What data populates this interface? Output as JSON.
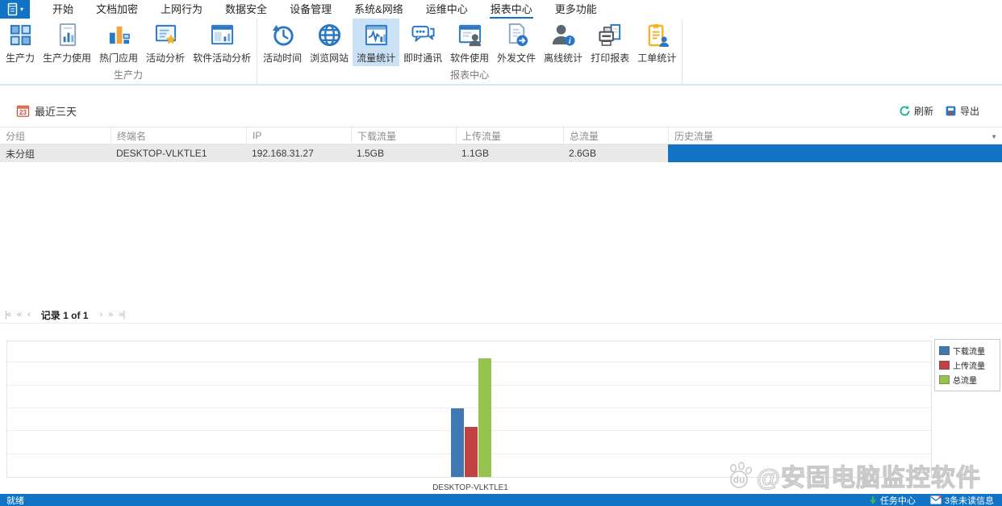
{
  "colors": {
    "accent": "#1173c5",
    "ribbon_highlight": "#cbe2f6",
    "row_background": "#e9e9e9"
  },
  "menu_bar": {
    "items": [
      {
        "label": "开始"
      },
      {
        "label": "文档加密"
      },
      {
        "label": "上网行为"
      },
      {
        "label": "数据安全"
      },
      {
        "label": "设备管理"
      },
      {
        "label": "系统&网络"
      },
      {
        "label": "运维中心"
      },
      {
        "label": "报表中心",
        "selected": true
      },
      {
        "label": "更多功能"
      }
    ]
  },
  "ribbon": {
    "groups": [
      {
        "label": "生产力",
        "buttons": [
          {
            "label": "生产力",
            "icon": "grid-icon"
          },
          {
            "label": "生产力使用",
            "icon": "doc-chart-icon"
          },
          {
            "label": "热门应用",
            "icon": "hot-apps-icon"
          },
          {
            "label": "活动分析",
            "icon": "doc-star-icon"
          },
          {
            "label": "软件活动分析",
            "icon": "window-chart-icon"
          }
        ]
      },
      {
        "label": "报表中心",
        "buttons": [
          {
            "label": "活动时间",
            "icon": "clock-history-icon"
          },
          {
            "label": "浏览网站",
            "icon": "globe-icon"
          },
          {
            "label": "流量统计",
            "icon": "traffic-chart-icon",
            "selected": true
          },
          {
            "label": "即时通讯",
            "icon": "chat-icon"
          },
          {
            "label": "软件使用",
            "icon": "window-user-icon"
          },
          {
            "label": "外发文件",
            "icon": "doc-export-icon"
          },
          {
            "label": "离线统计",
            "icon": "user-info-icon"
          },
          {
            "label": "打印报表",
            "icon": "printer-icon"
          },
          {
            "label": "工单统计",
            "icon": "clipboard-user-icon"
          }
        ]
      }
    ]
  },
  "toolbar": {
    "calendar_day": "23",
    "date_range": "最近三天",
    "refresh": "刷新",
    "export": "导出"
  },
  "table": {
    "columns": [
      "分组",
      "终端名",
      "IP",
      "下载流量",
      "上传流量",
      "总流量",
      "历史流量"
    ],
    "column_keys": [
      "group",
      "terminal",
      "ip",
      "download",
      "upload",
      "total",
      "history_bar"
    ],
    "rows": [
      {
        "group": "未分组",
        "terminal": "DESKTOP-VLKTLE1",
        "ip": "192.168.31.27",
        "download": "1.5GB",
        "upload": "1.1GB",
        "total": "2.6GB",
        "history_bar": true
      }
    ]
  },
  "pagination": {
    "left_controls": [
      "first-page",
      "fast-prev",
      "prev-page"
    ],
    "record_text": "记录 1 of 1",
    "right_controls": [
      "next-page",
      "fast-next",
      "last-page"
    ]
  },
  "chart_data": {
    "type": "bar",
    "title": "",
    "categories": [
      "DESKTOP-VLKTLE1"
    ],
    "series": [
      {
        "key": "download",
        "name": "下载流量",
        "color": "#3e79b4",
        "values": [
          1.5
        ]
      },
      {
        "key": "upload",
        "name": "上传流量",
        "color": "#bf4143",
        "values": [
          1.1
        ]
      },
      {
        "key": "total",
        "name": "总流量",
        "color": "#96c24e",
        "values": [
          2.6
        ]
      }
    ],
    "unit": "GB",
    "ylim": [
      0,
      3
    ],
    "gridline_step": 0.5,
    "grid": true,
    "y_axis_labels_visible": false,
    "legend_position": "top-right"
  },
  "watermark": {
    "paw_text": "du",
    "text": "@安固电脑监控软件"
  },
  "status_bar": {
    "ready": "就绪",
    "task_center": "任务中心",
    "unread": "3条未读信息"
  }
}
